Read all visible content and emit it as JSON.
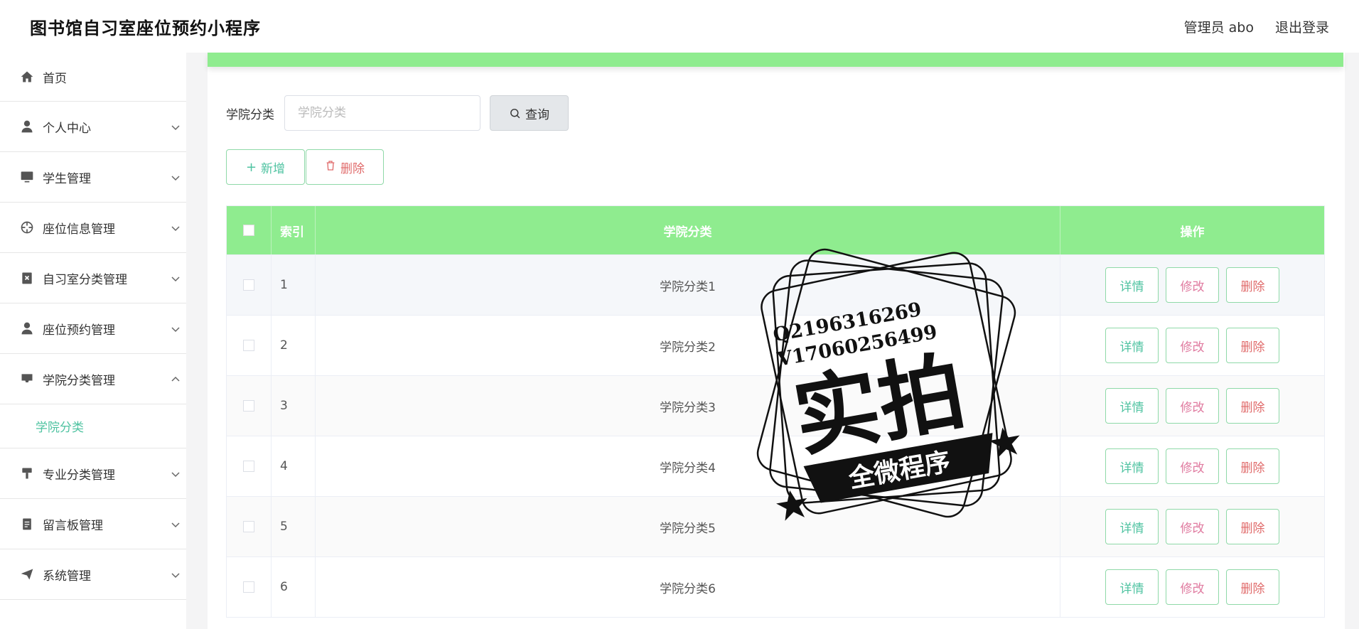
{
  "header": {
    "app_title": "图书馆自习室座位预约小程序",
    "admin_label": "管理员 abo",
    "logout_label": "退出登录"
  },
  "sidebar": {
    "items": [
      {
        "label": "首页",
        "icon": "home-icon"
      },
      {
        "label": "个人中心",
        "icon": "user-icon"
      },
      {
        "label": "学生管理",
        "icon": "monitor-icon"
      },
      {
        "label": "座位信息管理",
        "icon": "crosshair-icon"
      },
      {
        "label": "自习室分类管理",
        "icon": "clipboard-icon"
      },
      {
        "label": "座位预约管理",
        "icon": "user-icon"
      },
      {
        "label": "学院分类管理",
        "icon": "inbox-icon",
        "expanded": true
      },
      {
        "label": "专业分类管理",
        "icon": "brush-icon"
      },
      {
        "label": "留言板管理",
        "icon": "document-icon"
      },
      {
        "label": "系统管理",
        "icon": "send-icon"
      }
    ],
    "sub_item_label": "学院分类"
  },
  "search": {
    "label": "学院分类",
    "placeholder": "学院分类",
    "value": "",
    "query_label": "查询"
  },
  "actions": {
    "add_label": "新增",
    "delete_label": "删除"
  },
  "table": {
    "headers": {
      "index": "索引",
      "name": "学院分类",
      "ops": "操作"
    },
    "rows": [
      {
        "index": "1",
        "name": "学院分类1"
      },
      {
        "index": "2",
        "name": "学院分类2"
      },
      {
        "index": "3",
        "name": "学院分类3"
      },
      {
        "index": "4",
        "name": "学院分类4"
      },
      {
        "index": "5",
        "name": "学院分类5"
      },
      {
        "index": "6",
        "name": "学院分类6"
      }
    ],
    "op_labels": {
      "detail": "详情",
      "edit": "修改",
      "delete": "删除"
    }
  },
  "watermark": {
    "line1": "Q2196316269",
    "line2": "V17060256499",
    "main": "实拍",
    "banner": "全微程序"
  },
  "colors": {
    "accent_green": "#8fec8f",
    "teal_text": "#4fc3a1",
    "delete_red": "#e06b6b",
    "edit_pink": "#e07ba0"
  }
}
